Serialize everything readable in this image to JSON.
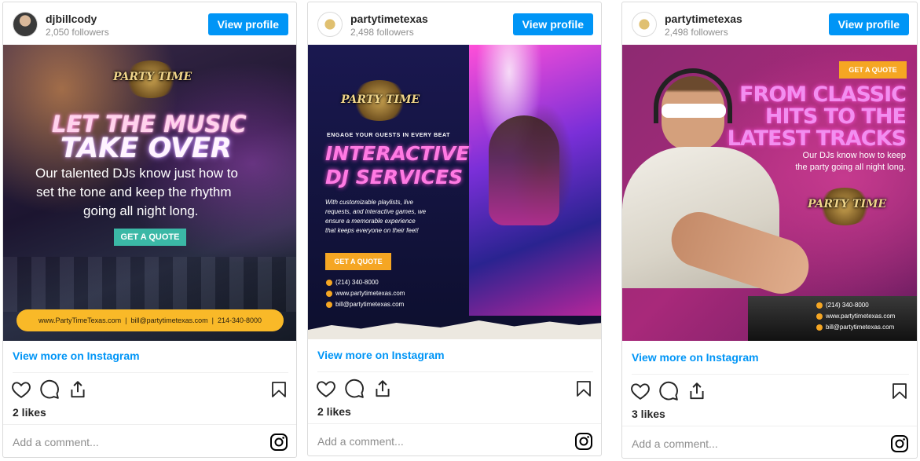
{
  "posts": [
    {
      "username": "djbillcody",
      "followers": "2,050 followers",
      "view_profile": "View profile",
      "view_more": "View more on Instagram",
      "likes": "2 likes",
      "comment_placeholder": "Add a comment...",
      "image": {
        "logo": "PARTY TIME",
        "headline_1": "LET THE MUSIC",
        "headline_2": "TAKE OVER",
        "body_1": "Our talented DJs know just how to",
        "body_2": "set the tone and keep the rhythm",
        "body_3": "going all night long.",
        "cta": "GET A QUOTE",
        "footer": "www.PartyTimeTexas.com  |  bill@partytimetexas.com  |  214-340-8000",
        "colors": {
          "bg": "#1c1530",
          "teal": "#3bb8a6",
          "footer": "#f9b928"
        }
      }
    },
    {
      "username": "partytimetexas",
      "followers": "2,498 followers",
      "view_profile": "View profile",
      "view_more": "View more on Instagram",
      "likes": "2 likes",
      "comment_placeholder": "Add a comment...",
      "image": {
        "logo": "PARTY TIME",
        "tagline": "ENGAGE YOUR GUESTS IN EVERY BEAT",
        "headline_1": "INTERACTIVE",
        "headline_2": "DJ SERVICES",
        "body_1": "With customizable playlists, live",
        "body_2": "requests, and interactive games, we",
        "body_3": "ensure a memorable experience",
        "body_4": "that keeps everyone on their feet!",
        "cta": "GET A QUOTE",
        "phone": "(214) 340-8000",
        "web": "www.partytimetexas.com",
        "email": "bill@partytimetexas.com",
        "colors": {
          "bg": "#0d0f2e",
          "pink": "#ff4fd8",
          "cta": "#f5a623"
        }
      }
    },
    {
      "username": "partytimetexas",
      "followers": "2,498 followers",
      "view_profile": "View profile",
      "view_more": "View more on Instagram",
      "likes": "3 likes",
      "comment_placeholder": "Add a comment...",
      "image": {
        "cta": "GET A QUOTE",
        "headline_1": "FROM CLASSIC",
        "headline_2": "HITS TO THE",
        "headline_3": "LATEST TRACKS",
        "body_1": "Our DJs know how to keep",
        "body_2": "the party going all night long.",
        "logo": "PARTY TIME",
        "phone": "(214) 340-8000",
        "web": "www.partytimetexas.com",
        "email": "bill@partytimetexas.com",
        "colors": {
          "bg": "#a8297a",
          "headline": "#f28ef0",
          "cta": "#f5a623"
        }
      }
    }
  ],
  "icons": [
    "heart-icon",
    "comment-icon",
    "share-icon",
    "bookmark-icon",
    "instagram-icon"
  ]
}
